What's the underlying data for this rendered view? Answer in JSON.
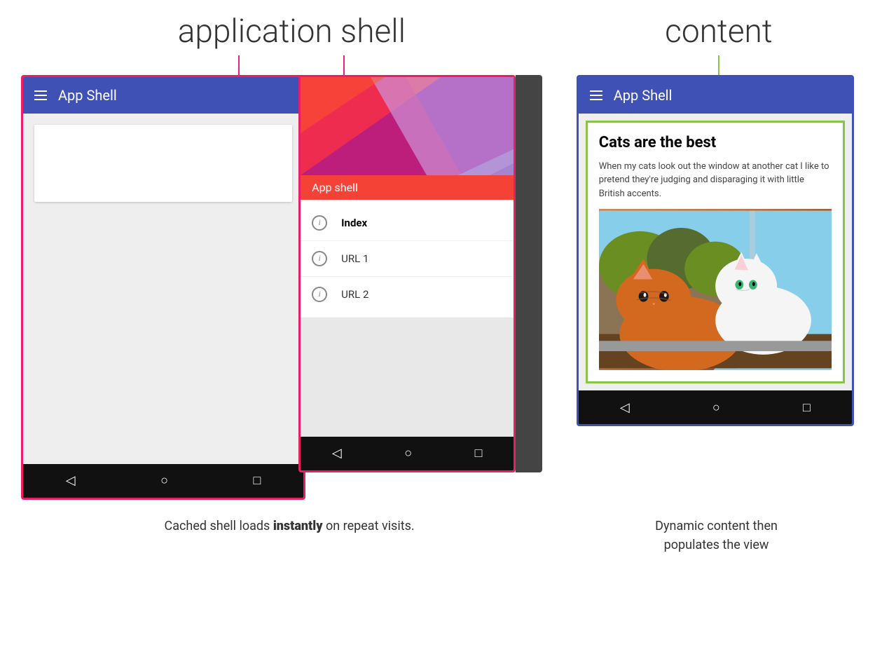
{
  "labels": {
    "application_shell": "application shell",
    "content": "content"
  },
  "phone1": {
    "app_bar_title": "App Shell",
    "content_blank": ""
  },
  "phone2": {
    "app_bar_title": "App Shell",
    "app_shell_overlay": "App shell",
    "menu_items": [
      {
        "label": "Index",
        "active": true
      },
      {
        "label": "URL 1",
        "active": false
      },
      {
        "label": "URL 2",
        "active": false
      }
    ]
  },
  "phone3": {
    "app_bar_title": "App Shell",
    "article": {
      "title": "Cats are the best",
      "body": "When my cats look out the window at another cat I like to pretend they're judging and disparaging it with little British accents."
    }
  },
  "nav_buttons": {
    "back": "◁",
    "home": "○",
    "recents": "□"
  },
  "captions": {
    "left": "Cached shell loads",
    "left_bold": "instantly",
    "left_end": "on repeat visits.",
    "right_line1": "Dynamic content then",
    "right_line2": "populates the view"
  }
}
